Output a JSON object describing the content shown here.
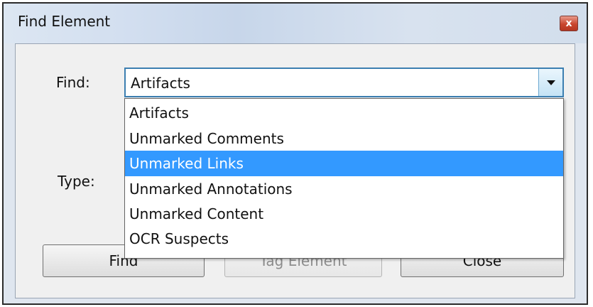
{
  "dialog": {
    "title": "Find Element",
    "close_symbol": "x"
  },
  "find": {
    "label": "Find:",
    "selected_value": "Artifacts",
    "options": [
      "Artifacts",
      "Unmarked Comments",
      "Unmarked Links",
      "Unmarked Annotations",
      "Unmarked Content",
      "OCR Suspects"
    ],
    "highlighted_option": "Unmarked Links"
  },
  "type": {
    "label": "Type:"
  },
  "buttons": {
    "find": "Find",
    "tag_element": "Tag Element",
    "close": "Close"
  },
  "icons": {
    "close": "close-icon",
    "dropdown": "chevron-down-icon"
  },
  "colors": {
    "highlight": "#3399ff",
    "close_button": "#c9462f"
  }
}
